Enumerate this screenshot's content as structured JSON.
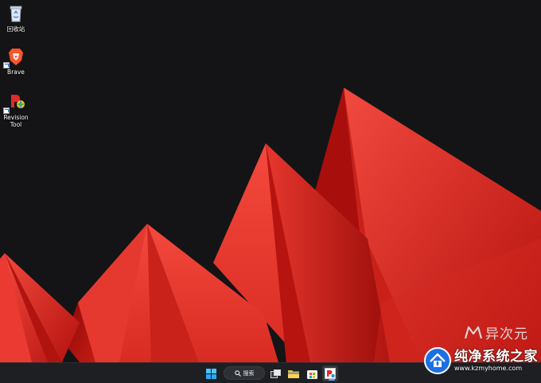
{
  "desktop": {
    "icons": [
      {
        "label": "回收站",
        "icon": "recycle-bin-icon"
      },
      {
        "label": "Brave",
        "icon": "brave-lion-icon"
      },
      {
        "label": "Revision\nTool",
        "icon": "revision-tool-icon"
      }
    ]
  },
  "taskbar": {
    "search_label": "搜索",
    "items": [
      "windows-start-icon",
      "search-icon",
      "task-view-icon",
      "file-explorer-icon",
      "microsoft-store-icon",
      "revision-tool-icon"
    ]
  },
  "watermark": {
    "text": "异次元"
  },
  "brand": {
    "name": "纯净系统之家",
    "url": "www.kzmyhome.com"
  },
  "colors": {
    "wallpaper_bg": "#141416",
    "accent_red": "#e8322b",
    "taskbar_bg": "#1d1f22",
    "brand_blue": "#1d6fe3"
  }
}
